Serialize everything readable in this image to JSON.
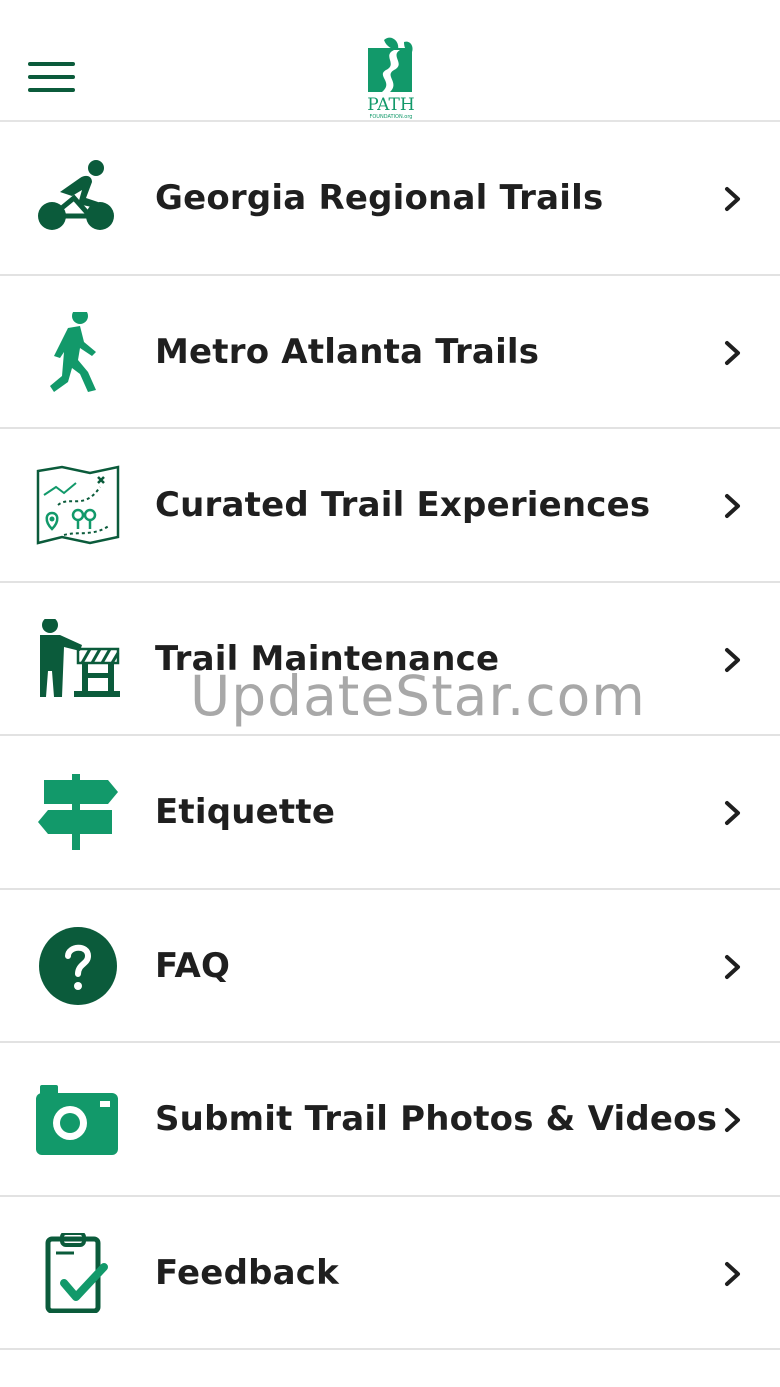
{
  "header": {
    "logo_text": "PATH",
    "logo_subtext": "FOUNDATION.org"
  },
  "menu": {
    "items": [
      {
        "label": "Georgia Regional Trails",
        "icon": "cyclist-icon"
      },
      {
        "label": "Metro Atlanta Trails",
        "icon": "hiker-icon"
      },
      {
        "label": "Curated Trail Experiences",
        "icon": "trail-map-icon"
      },
      {
        "label": "Trail Maintenance",
        "icon": "maintenance-worker-icon"
      },
      {
        "label": "Etiquette",
        "icon": "signpost-icon"
      },
      {
        "label": "FAQ",
        "icon": "question-circle-icon"
      },
      {
        "label": "Submit Trail Photos & Videos",
        "icon": "camera-icon"
      },
      {
        "label": "Feedback",
        "icon": "clipboard-check-icon"
      }
    ]
  },
  "watermark": "UpdateStar.com",
  "colors": {
    "primary_dark": "#0b5b3b",
    "primary": "#12996a",
    "text": "#1f1f1f"
  }
}
